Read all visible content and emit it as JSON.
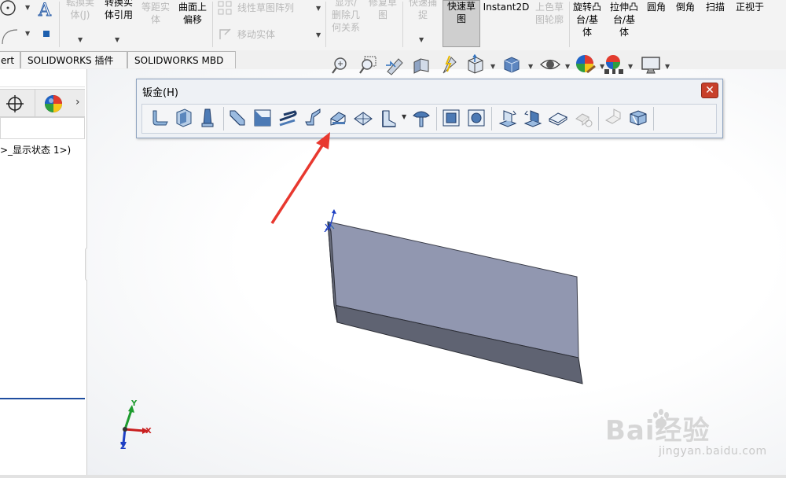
{
  "ribbon": {
    "buttons": [
      {
        "label": "転換実\n体(J)",
        "dim": true
      },
      {
        "label": "转换实\n体引用",
        "dim": false
      },
      {
        "label": "等距实\n体",
        "dim": true
      },
      {
        "label": "曲面上\n偏移",
        "dim": false
      },
      {
        "label": "线性草图阵列",
        "dim": true
      },
      {
        "label": "移动实体",
        "dim": true
      },
      {
        "label": "显示/\n删除几\n何关系",
        "dim": true
      },
      {
        "label": "修复草\n图",
        "dim": true
      },
      {
        "label": "快速捕\n捉",
        "dim": true
      },
      {
        "label": "快速草\n图",
        "dim": false
      },
      {
        "label": "Instant2D",
        "dim": false
      },
      {
        "label": "上色草\n图轮廓",
        "dim": true
      },
      {
        "label": "旋转凸\n台/基\n体",
        "dim": false
      },
      {
        "label": "拉伸凸\n台/基\n体",
        "dim": false
      },
      {
        "label": "圆角",
        "dim": false
      },
      {
        "label": "倒角",
        "dim": false
      },
      {
        "label": "扫描",
        "dim": false
      },
      {
        "label": "正视于",
        "dim": false
      }
    ]
  },
  "tabs": [
    {
      "label": "ert"
    },
    {
      "label": "SOLIDWORKS 插件"
    },
    {
      "label": "SOLIDWORKS MBD"
    }
  ],
  "left_panel": {
    "tree_text": ">_显示状态 1>)"
  },
  "sheet_metal_toolbar": {
    "title": "钣金(H)",
    "close_glyph": "✕"
  },
  "icons": {
    "sketch_circle": "circle-icon",
    "text": "text-icon",
    "close": "close-icon"
  },
  "triad": {
    "x": "X",
    "y": "Y",
    "z": "Z"
  },
  "watermark": {
    "brand": "Bai经验",
    "url": "jingyan.baidu.com"
  },
  "colors": {
    "part_top": "#9197b0",
    "part_side": "#505461",
    "arrow": "#e8382f",
    "close_button": "#c8402a"
  }
}
